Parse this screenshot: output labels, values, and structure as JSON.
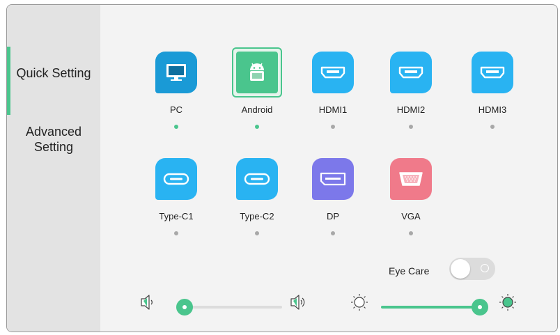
{
  "sidebar": {
    "items": [
      {
        "label": "Quick Setting",
        "active": true
      },
      {
        "label": "Advanced Setting",
        "active": false
      }
    ]
  },
  "sources": [
    {
      "label": "PC",
      "icon": "monitor-icon",
      "color": "#1a9ad6",
      "indicator": "active"
    },
    {
      "label": "Android",
      "icon": "android-icon",
      "color": "#4ac58d",
      "indicator": "active",
      "selected": true
    },
    {
      "label": "HDMI1",
      "icon": "hdmi-icon",
      "color": "#29b3f2",
      "indicator": "inactive"
    },
    {
      "label": "HDMI2",
      "icon": "hdmi-icon",
      "color": "#29b3f2",
      "indicator": "inactive"
    },
    {
      "label": "HDMI3",
      "icon": "hdmi-icon",
      "color": "#29b3f2",
      "indicator": "inactive"
    },
    {
      "label": "Type-C1",
      "icon": "usb-c-icon",
      "color": "#29b3f2",
      "indicator": "inactive"
    },
    {
      "label": "Type-C2",
      "icon": "usb-c-icon",
      "color": "#29b3f2",
      "indicator": "inactive"
    },
    {
      "label": "DP",
      "icon": "displayport-icon",
      "color": "#7c78ea",
      "indicator": "inactive"
    },
    {
      "label": "VGA",
      "icon": "vga-icon",
      "color": "#f07a8a",
      "indicator": "inactive"
    }
  ],
  "eye_care": {
    "label": "Eye Care",
    "enabled": false
  },
  "volume": {
    "level": 0.0,
    "min_icon": "volume-low-icon",
    "max_icon": "volume-high-icon"
  },
  "brightness": {
    "level": 1.0,
    "min_icon": "brightness-low-icon",
    "max_icon": "brightness-high-icon"
  },
  "colors": {
    "accent": "#4ac58d",
    "sidebar": "#e3e3e3",
    "panel": "#f3f3f3"
  }
}
